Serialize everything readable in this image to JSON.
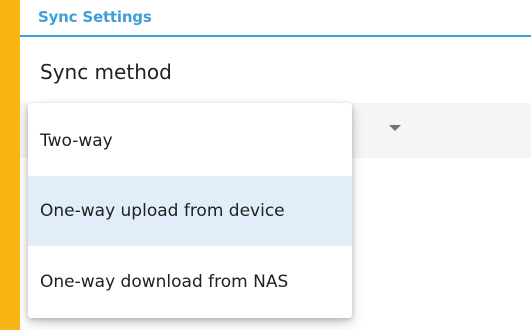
{
  "colors": {
    "background": "#F8B514",
    "accent": "#3D9FD7",
    "selected_item": "#E1EEFA"
  },
  "header": {
    "title": "Sync Settings"
  },
  "sync_method": {
    "label": "Sync method",
    "dropdown_icon": "triangle-down-icon",
    "options": [
      {
        "label": "Two-way",
        "selected": false
      },
      {
        "label": "One-way upload from device",
        "selected": true
      },
      {
        "label": "One-way download from NAS",
        "selected": false
      }
    ]
  }
}
